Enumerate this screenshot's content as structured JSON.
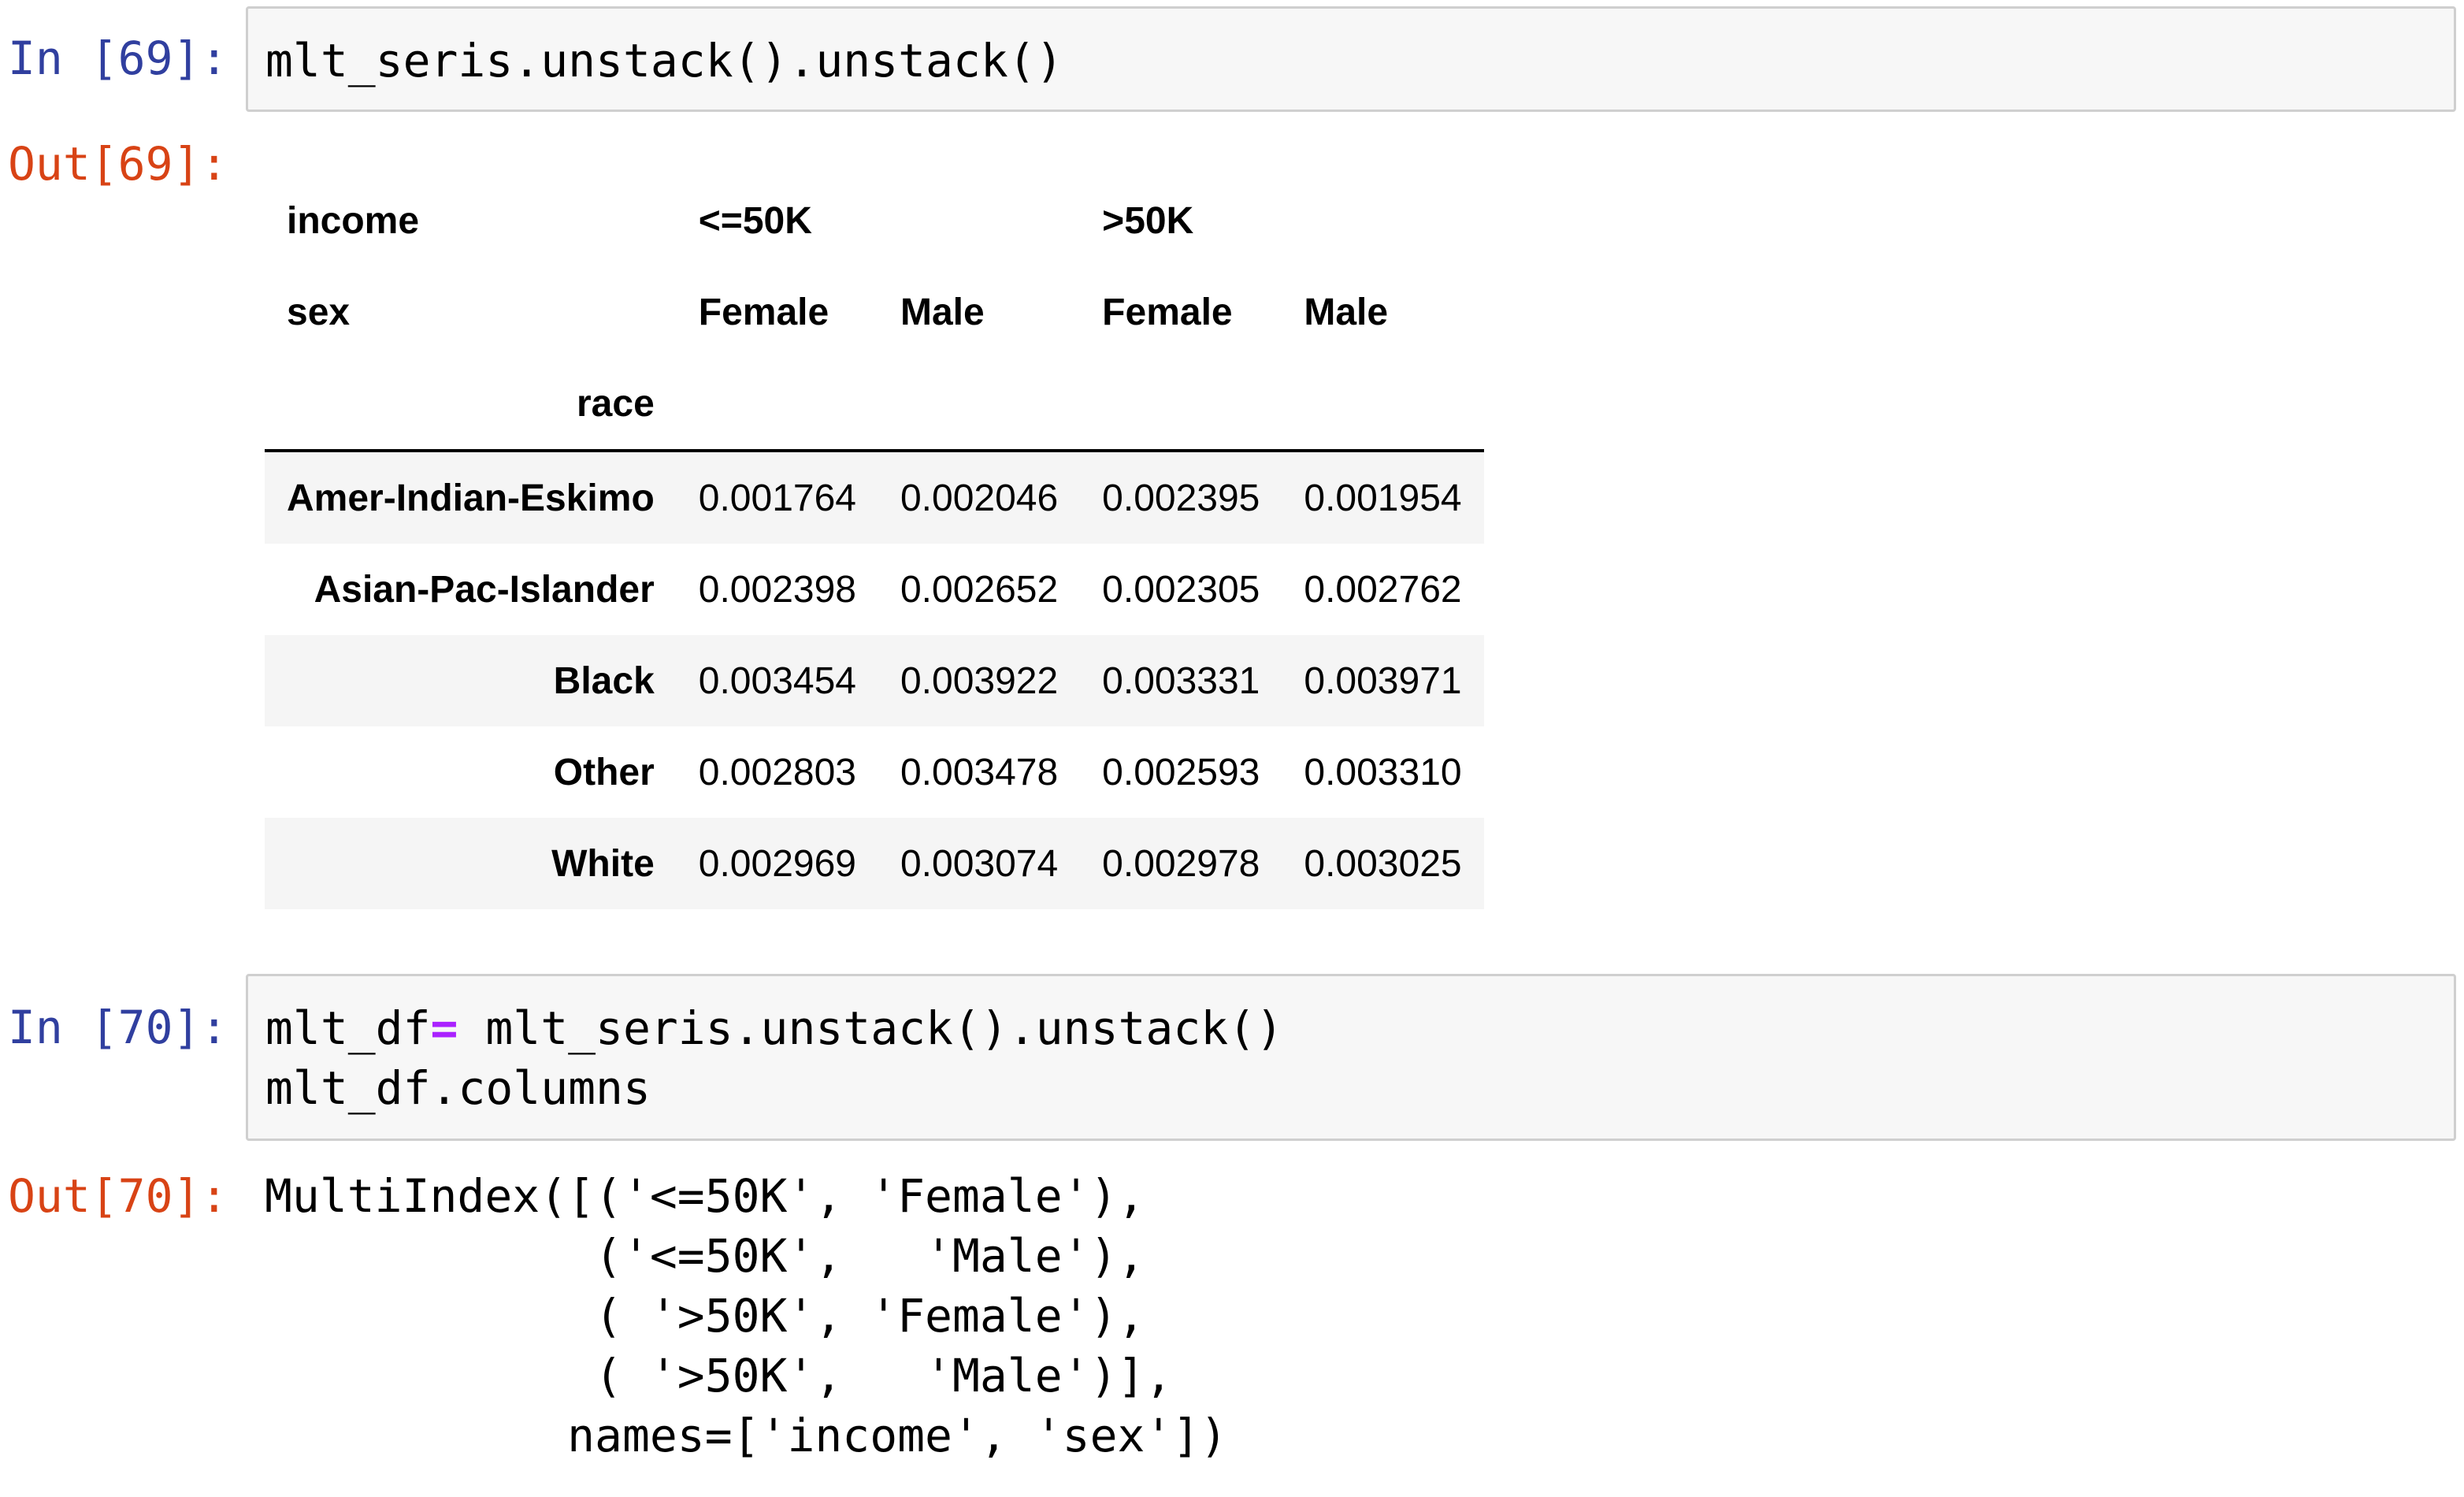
{
  "cells": {
    "in69": {
      "prompt": "In [69]:",
      "code": "mlt_seris.unstack().unstack()"
    },
    "out69": {
      "prompt": "Out[69]:",
      "header": {
        "row1_label": "income",
        "row2_label": "sex",
        "row3_label": "race",
        "income_groups": [
          "<=50K",
          ">50K"
        ],
        "sex_labels": [
          "Female",
          "Male",
          "Female",
          "Male"
        ]
      },
      "rows": [
        {
          "race": "Amer-Indian-Eskimo",
          "values": [
            "0.001764",
            "0.002046",
            "0.002395",
            "0.001954"
          ]
        },
        {
          "race": "Asian-Pac-Islander",
          "values": [
            "0.002398",
            "0.002652",
            "0.002305",
            "0.002762"
          ]
        },
        {
          "race": "Black",
          "values": [
            "0.003454",
            "0.003922",
            "0.003331",
            "0.003971"
          ]
        },
        {
          "race": "Other",
          "values": [
            "0.002803",
            "0.003478",
            "0.002593",
            "0.003310"
          ]
        },
        {
          "race": "White",
          "values": [
            "0.002969",
            "0.003074",
            "0.002978",
            "0.003025"
          ]
        }
      ]
    },
    "in70": {
      "prompt": "In [70]:",
      "line1_var": "mlt_df",
      "line1_op": "=",
      "line1_rest": " mlt_seris.unstack().unstack()",
      "line2": "mlt_df.columns"
    },
    "out70": {
      "prompt": "Out[70]:",
      "lines": [
        "MultiIndex([('<=50K', 'Female'),",
        "            ('<=50K',   'Male'),",
        "            ( '>50K', 'Female'),",
        "            ( '>50K',   'Male')],",
        "           names=['income', 'sex'])"
      ]
    }
  }
}
